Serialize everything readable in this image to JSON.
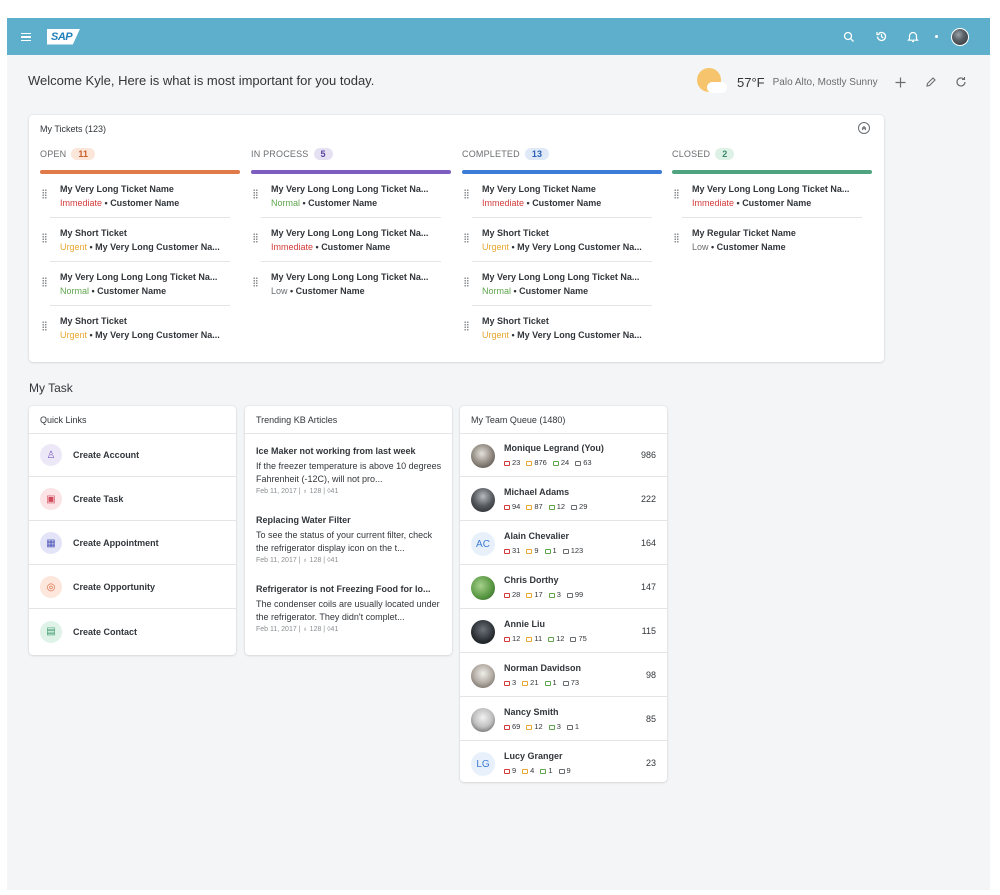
{
  "shell": {
    "logo": "SAP"
  },
  "welcome": "Welcome Kyle, Here is what is most important for you today.",
  "weather": {
    "temp": "57°F",
    "location": "Palo Alto, Mostly Sunny"
  },
  "tickets": {
    "title": "My Tickets (123)",
    "columns": [
      {
        "label": "OPEN",
        "count": "11",
        "color": "#e07a48",
        "badge_bg": "#fbe6d9",
        "badge_fg": "#c8602c",
        "items": [
          {
            "name": "My Very Long Ticket Name",
            "priority": "Immediate",
            "pcolor": "#d33b3b",
            "customer": "Customer Name"
          },
          {
            "name": "My Short Ticket",
            "priority": "Urgent",
            "pcolor": "#e9a630",
            "customer": "My Very Long Customer Na..."
          },
          {
            "name": "My Very Long Long Long Ticket Na...",
            "priority": "Normal",
            "pcolor": "#5fa54e",
            "customer": "Customer Name"
          },
          {
            "name": "My Short Ticket",
            "priority": "Urgent",
            "pcolor": "#e9a630",
            "customer": "My Very Long Customer Na..."
          }
        ]
      },
      {
        "label": "IN PROCESS",
        "count": "5",
        "color": "#7d5dbf",
        "badge_bg": "#e6e0f3",
        "badge_fg": "#5e45a0",
        "items": [
          {
            "name": "My Very Long Long Long Ticket Na...",
            "priority": "Normal",
            "pcolor": "#5fa54e",
            "customer": "Customer Name"
          },
          {
            "name": "My Very Long Long Long Ticket Na...",
            "priority": "Immediate",
            "pcolor": "#d33b3b",
            "customer": "Customer Name"
          },
          {
            "name": "My Very Long Long Long Ticket Na...",
            "priority": "Low",
            "pcolor": "#6a6d70",
            "customer": "Customer Name"
          }
        ]
      },
      {
        "label": "COMPLETED",
        "count": "13",
        "color": "#3c7bd6",
        "badge_bg": "#dfe9f8",
        "badge_fg": "#2a62b6",
        "items": [
          {
            "name": "My Very Long Ticket Name",
            "priority": "Immediate",
            "pcolor": "#d33b3b",
            "customer": "Customer Name"
          },
          {
            "name": "My Short Ticket",
            "priority": "Urgent",
            "pcolor": "#e9a630",
            "customer": "My Very Long Customer Na..."
          },
          {
            "name": "My Very Long Long Long Ticket Na...",
            "priority": "Normal",
            "pcolor": "#5fa54e",
            "customer": "Customer Name"
          },
          {
            "name": "My Short Ticket",
            "priority": "Urgent",
            "pcolor": "#e9a630",
            "customer": "My Very Long Customer Na..."
          }
        ]
      },
      {
        "label": "CLOSED",
        "count": "2",
        "color": "#4fa37f",
        "badge_bg": "#def1e7",
        "badge_fg": "#3a8a66",
        "items": [
          {
            "name": "My Very Long Long Long Ticket Na...",
            "priority": "Immediate",
            "pcolor": "#d33b3b",
            "customer": "Customer Name"
          },
          {
            "name": "My Regular Ticket Name",
            "priority": "Low",
            "pcolor": "#6a6d70",
            "customer": "Customer Name"
          }
        ]
      }
    ]
  },
  "my_task": {
    "title": "My Task"
  },
  "quick_links": {
    "title": "Quick Links",
    "items": [
      {
        "label": "Create Account",
        "icon": "user-icon",
        "glyph": "♙",
        "bg": "#ece8f7",
        "fg": "#7d5dbf"
      },
      {
        "label": "Create Task",
        "icon": "task-icon",
        "glyph": "▣",
        "bg": "#fbe3e6",
        "fg": "#d04a5c"
      },
      {
        "label": "Create Appointment",
        "icon": "calendar-icon",
        "glyph": "▦",
        "bg": "#e3e4f7",
        "fg": "#4f56b8"
      },
      {
        "label": "Create Opportunity",
        "icon": "opportunity-icon",
        "glyph": "◎",
        "bg": "#fde6dc",
        "fg": "#d8673b"
      },
      {
        "label": "Create Contact",
        "icon": "contact-icon",
        "glyph": "▤",
        "bg": "#dff2e8",
        "fg": "#3a9a6c"
      }
    ]
  },
  "kb": {
    "title": "Trending KB Articles",
    "articles": [
      {
        "title": "Ice Maker not working from last week",
        "body": "If the freezer temperature is above 10 degrees Fahrenheit (-12C), will not pro...",
        "date": "Feb 11, 2017",
        "likes": "128",
        "comments": "41"
      },
      {
        "title": "Replacing Water Filter",
        "body": "To see the status of your current filter, check the refrigerator display icon on the t...",
        "date": "Feb 11, 2017",
        "likes": "128",
        "comments": "41"
      },
      {
        "title": "Refrigerator is not Freezing Food for lo...",
        "body": "The condenser coils are usually located under the refrigerator. They didn't complet...",
        "date": "Feb 11, 2017",
        "likes": "128",
        "comments": "41"
      }
    ]
  },
  "team": {
    "title": "My Team Queue (1480)",
    "members": [
      {
        "name": "Monique Legrand (You)",
        "initials": "",
        "avatar": "photo",
        "s": [
          "23",
          "876",
          "24",
          "63"
        ],
        "count": "986"
      },
      {
        "name": "Michael Adams",
        "initials": "",
        "avatar": "photo",
        "s": [
          "94",
          "87",
          "12",
          "29"
        ],
        "count": "222"
      },
      {
        "name": "Alain Chevalier",
        "initials": "AC",
        "avatar": "initials",
        "s": [
          "31",
          "9",
          "1",
          "123"
        ],
        "count": "164"
      },
      {
        "name": "Chris Dorthy",
        "initials": "",
        "avatar": "photo",
        "s": [
          "28",
          "17",
          "3",
          "99"
        ],
        "count": "147"
      },
      {
        "name": "Annie Liu",
        "initials": "",
        "avatar": "photo",
        "s": [
          "12",
          "11",
          "12",
          "75"
        ],
        "count": "115"
      },
      {
        "name": "Norman Davidson",
        "initials": "",
        "avatar": "photo",
        "s": [
          "3",
          "21",
          "1",
          "73"
        ],
        "count": "98"
      },
      {
        "name": "Nancy Smith",
        "initials": "",
        "avatar": "photo",
        "s": [
          "69",
          "12",
          "3",
          "1"
        ],
        "count": "85"
      },
      {
        "name": "Lucy Granger",
        "initials": "LG",
        "avatar": "initials",
        "s": [
          "9",
          "4",
          "1",
          "9"
        ],
        "count": "23"
      }
    ],
    "stat_colors": [
      "#d33b3b",
      "#e9a630",
      "#5fa54e",
      "#6a6d70"
    ]
  },
  "colors": {
    "shell": "#5eafcb",
    "page_bg": "#f4f5f6"
  }
}
